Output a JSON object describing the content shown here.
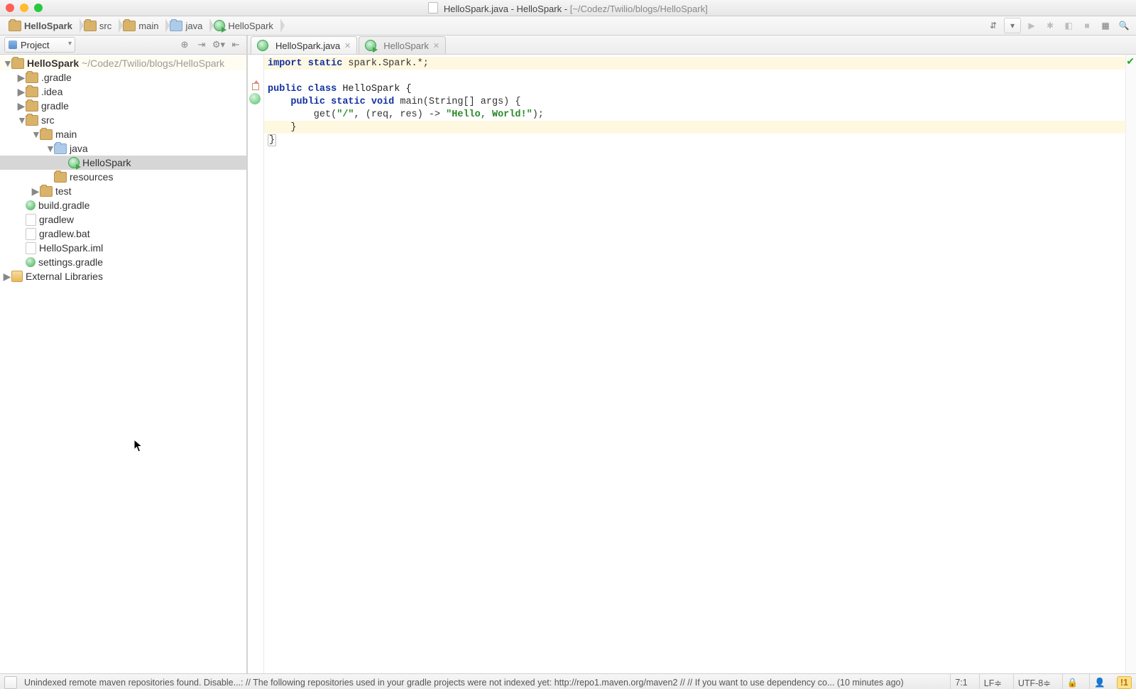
{
  "window": {
    "title_file": "HelloSpark.java",
    "title_project": "HelloSpark",
    "title_path": "[~/Codez/Twilio/blogs/HelloSpark]"
  },
  "breadcrumb": [
    {
      "label": "HelloSpark",
      "name": "crumb-project",
      "icon": "folder"
    },
    {
      "label": "src",
      "name": "crumb-src",
      "icon": "folder"
    },
    {
      "label": "main",
      "name": "crumb-main",
      "icon": "folder"
    },
    {
      "label": "java",
      "name": "crumb-java",
      "icon": "folder-blue"
    },
    {
      "label": "HelloSpark",
      "name": "crumb-class",
      "icon": "class-run"
    }
  ],
  "nav_right_icons": {
    "make": "build-icon",
    "run_config": "run-config-dropdown",
    "run": "run-icon",
    "debug": "debug-icon",
    "coverage": "coverage-icon",
    "stop": "stop-icon",
    "project_structure": "project-structure-icon",
    "search": "search-icon"
  },
  "project_panel": {
    "combo_label": "Project",
    "toolbar_icons": [
      "locate-icon",
      "collapse-icon",
      "settings-icon",
      "hide-icon"
    ]
  },
  "tree": {
    "root_name": "HelloSpark",
    "root_path": "~/Codez/Twilio/blogs/HelloSpark",
    "ext_libs": "External Libraries",
    "items": [
      {
        "label": ".gradle",
        "indent": 1,
        "icon": "folder",
        "disclosure": "▶"
      },
      {
        "label": ".idea",
        "indent": 1,
        "icon": "folder",
        "disclosure": "▶"
      },
      {
        "label": "gradle",
        "indent": 1,
        "icon": "folder",
        "disclosure": "▶"
      },
      {
        "label": "src",
        "indent": 1,
        "icon": "folder",
        "disclosure": "▼"
      },
      {
        "label": "main",
        "indent": 2,
        "icon": "folder",
        "disclosure": "▼"
      },
      {
        "label": "java",
        "indent": 3,
        "icon": "folder-blue",
        "disclosure": "▼"
      },
      {
        "label": "HelloSpark",
        "indent": 4,
        "icon": "class-run",
        "selected": true
      },
      {
        "label": "resources",
        "indent": 3,
        "icon": "folder",
        "disclosure": ""
      },
      {
        "label": "test",
        "indent": 2,
        "icon": "folder",
        "disclosure": "▶"
      },
      {
        "label": "build.gradle",
        "indent": 1,
        "icon": "gradle",
        "disclosure": ""
      },
      {
        "label": "gradlew",
        "indent": 1,
        "icon": "file",
        "disclosure": ""
      },
      {
        "label": "gradlew.bat",
        "indent": 1,
        "icon": "file",
        "disclosure": ""
      },
      {
        "label": "HelloSpark.iml",
        "indent": 1,
        "icon": "file",
        "disclosure": ""
      },
      {
        "label": "settings.gradle",
        "indent": 1,
        "icon": "gradle",
        "disclosure": ""
      }
    ]
  },
  "tabs": [
    {
      "label": "HelloSpark.java",
      "icon": "class",
      "active": true
    },
    {
      "label": "HelloSpark",
      "icon": "class-run",
      "active": false
    }
  ],
  "code": {
    "l1a": "import",
    "l1b": "static",
    "l1c": " spark.Spark.*;",
    "l2": "",
    "l3a": "public",
    "l3b": "class",
    "l3c": " HelloSpark {",
    "l4a": "public",
    "l4b": "static",
    "l4c": "void",
    "l4d": " main(String[] args) {",
    "l5a": "        get(",
    "l5b": "\"/\"",
    "l5c": ", (req, res) -> ",
    "l5d": "\"Hello, World!\"",
    "l5e": ");",
    "l6": "    }",
    "l7": "}"
  },
  "status": {
    "msg": "Unindexed remote maven repositories found. Disable...: // The following repositories used in your gradle projects were not indexed yet: http://repo1.maven.org/maven2 // // If you want to use dependency co... (10 minutes ago)",
    "pos": "7:1",
    "eol": "LF≑",
    "enc": "UTF-8≑",
    "lock": "lock-icon",
    "inspect": "inspector-icon",
    "warn": "!1"
  }
}
